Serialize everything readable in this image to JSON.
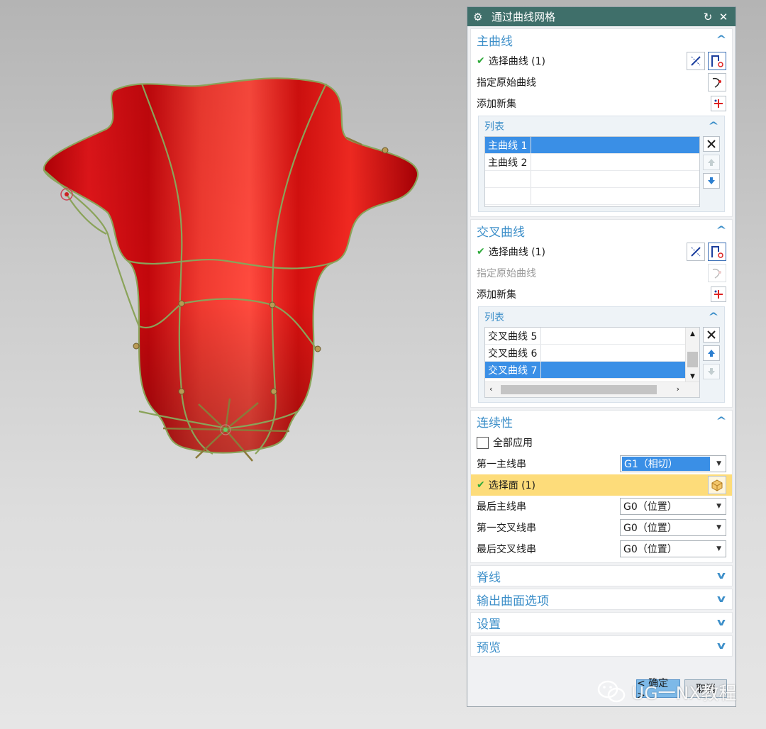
{
  "dialog": {
    "title": "通过曲线网格",
    "sections": {
      "primary": {
        "title": "主曲线",
        "select_curve": "选择曲线 (1)",
        "specify_origin": "指定原始曲线",
        "add_new_set": "添加新集",
        "list_title": "列表",
        "items": [
          "主曲线 1",
          "主曲线 2"
        ]
      },
      "cross": {
        "title": "交叉曲线",
        "select_curve": "选择曲线 (1)",
        "specify_origin": "指定原始曲线",
        "add_new_set": "添加新集",
        "list_title": "列表",
        "items": [
          "交叉曲线 5",
          "交叉曲线 6",
          "交叉曲线 7"
        ]
      },
      "continuity": {
        "title": "连续性",
        "apply_all": "全部应用",
        "first_primary": "第一主线串",
        "first_primary_value": "G1（相切）",
        "select_face": "选择面 (1)",
        "last_primary": "最后主线串",
        "last_primary_value": "G0（位置）",
        "first_cross": "第一交叉线串",
        "first_cross_value": "G0（位置）",
        "last_cross": "最后交叉线串",
        "last_cross_value": "G0（位置）"
      },
      "collapsed": [
        "脊线",
        "输出曲面选项",
        "设置",
        "预览"
      ]
    },
    "footer": {
      "ok": "< 确定 >",
      "cancel": "取消"
    }
  },
  "watermark": "UG一NX教程",
  "icons": [
    "settings-gear-icon",
    "reset-icon",
    "close-icon",
    "curve-rule-icon",
    "curve-select-icon",
    "origin-curve-icon",
    "add-set-icon",
    "delete-icon",
    "move-up-icon",
    "move-down-icon",
    "face-select-icon"
  ],
  "colors": {
    "title_bar": "#3f6f6a",
    "section_header": "#3d8fc9",
    "selection": "#3a8fe6",
    "highlight_row": "#fddc7a",
    "check": "#2eaa3a",
    "surface": "#e8141a",
    "curve": "#8aa35a"
  }
}
